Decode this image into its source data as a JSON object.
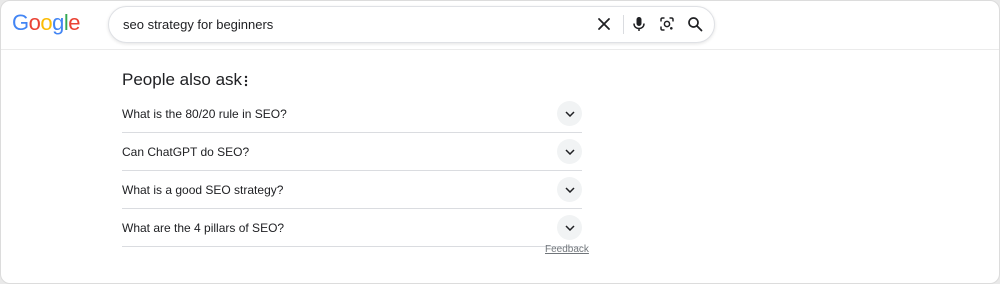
{
  "logo": {
    "letters": [
      "G",
      "o",
      "o",
      "g",
      "l",
      "e"
    ],
    "colors": [
      "#4285F4",
      "#EA4335",
      "#FBBC05",
      "#4285F4",
      "#34A853",
      "#EA4335"
    ]
  },
  "search": {
    "query": "seo strategy for beginners",
    "icons": {
      "clear": "close-icon",
      "voice": "microphone-icon",
      "lens": "camera-icon",
      "search": "search-icon"
    }
  },
  "paa": {
    "title": "People also ask",
    "questions": [
      "What is the 80/20 rule in SEO?",
      "Can ChatGPT do SEO?",
      "What is a good SEO strategy?",
      "What are the 4 pillars of SEO?"
    ],
    "feedback": "Feedback"
  }
}
